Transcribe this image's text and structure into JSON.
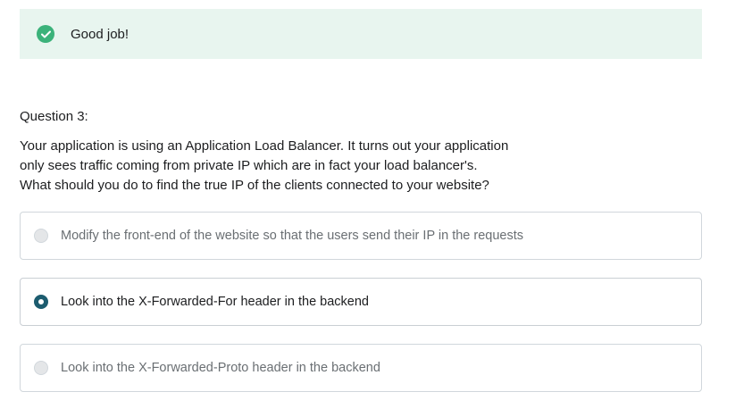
{
  "feedback": {
    "message": "Good job!",
    "icon": "check-circle-icon",
    "accent": "#3bb27a",
    "background": "#e8f5ef"
  },
  "question": {
    "label": "Question 3:",
    "lines": [
      "Your application is using an Application Load Balancer. It turns out your application",
      "only sees traffic coming from private IP which are in fact your load balancer's.",
      "What should you do to find the true IP of the clients connected to your website?"
    ]
  },
  "answers": [
    {
      "label": "Modify the front-end of the website so that the users send their IP in the requests",
      "selected": false
    },
    {
      "label": "Look into the X-Forwarded-For header in the backend",
      "selected": true
    },
    {
      "label": "Look into the X-Forwarded-Proto header in the backend",
      "selected": false
    }
  ],
  "colors": {
    "radio_selected": "#1c5c6f",
    "border": "#d1d7dc"
  }
}
